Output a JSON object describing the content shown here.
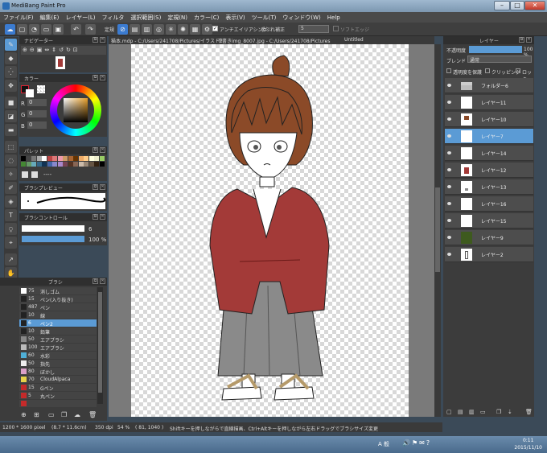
{
  "window": {
    "title": "MediBang Paint Pro"
  },
  "menu": [
    "ファイル(F)",
    "編集(E)",
    "レイヤー(L)",
    "フィルタ",
    "選択範囲(S)",
    "定規(N)",
    "カラー(C)",
    "表示(V)",
    "ツール(T)",
    "ウィンドウ(W)",
    "Help"
  ],
  "toolbar": {
    "ruler_label": "定規",
    "antialias_label": "アンチエイリアシング",
    "stabilizer_label": "手ぶれ補正",
    "stabilizer_value": "5",
    "soft_edge_label": "ソフトエッジ"
  },
  "doc_tabs": [
    "猫本.mdp - C:/Users/241708/Pictures/イラスト2",
    "下書きimg_8007.jpg - C:/Users/241708/Pictures",
    "Untitled"
  ],
  "navigator": {
    "title": "ナビゲーター"
  },
  "color": {
    "title": "カラー",
    "r": "0",
    "g": "0",
    "b": "0"
  },
  "palette": {
    "title": "パレット",
    "none_label": "----"
  },
  "brush_preview": {
    "title": "ブラシプレビュー"
  },
  "brush_control": {
    "title": "ブラシコントロール",
    "size_value": "6",
    "opacity_value": "100 %"
  },
  "brush_panel": {
    "title": "ブラシ",
    "items": [
      {
        "size": "75",
        "name": "消しゴム",
        "color": "#ffffff"
      },
      {
        "size": "15",
        "name": "ペン(入り抜き)",
        "color": "#222222"
      },
      {
        "size": "487",
        "name": "ペン",
        "color": "#222222"
      },
      {
        "size": "10",
        "name": "線",
        "color": "#222222"
      },
      {
        "size": "6",
        "name": "ペン2",
        "color": "#222222",
        "selected": true
      },
      {
        "size": "10",
        "name": "鉛筆",
        "color": "#222222"
      },
      {
        "size": "50",
        "name": "エアブラシ",
        "color": "#888888"
      },
      {
        "size": "100",
        "name": "エアブラシ",
        "color": "#bbbbbb"
      },
      {
        "size": "60",
        "name": "水彩",
        "color": "#4fb0d8"
      },
      {
        "size": "50",
        "name": "指先",
        "color": "#eeeeee"
      },
      {
        "size": "80",
        "name": "ぼかし",
        "color": "#d9a0c8"
      },
      {
        "size": "70",
        "name": "CloudAlpaca",
        "color": "#e6d24a"
      },
      {
        "size": "15",
        "name": "Gペン",
        "color": "#c52a2a"
      },
      {
        "size": "5",
        "name": "丸ペン",
        "color": "#c52a2a"
      },
      {
        "size": "",
        "name": "",
        "color": "#c52a2a"
      }
    ]
  },
  "layers_panel": {
    "title": "レイヤー",
    "opacity_label": "不透明度",
    "opacity_value": "100 %",
    "blend_label": "ブレンド",
    "blend_value": "通常",
    "protect_label": "透明度を保護",
    "clipping_label": "クリッピング",
    "lock_label": "ロック",
    "layers": [
      {
        "name": "フォルダー6",
        "thumb": "folder"
      },
      {
        "name": "レイヤー11",
        "thumb": "blank"
      },
      {
        "name": "レイヤー10",
        "thumb": "hair"
      },
      {
        "name": "レイヤー7",
        "thumb": "blank",
        "selected": true
      },
      {
        "name": "レイヤー14",
        "thumb": "blank"
      },
      {
        "name": "レイヤー12",
        "thumb": "kimono"
      },
      {
        "name": "レイヤー13",
        "thumb": "small"
      },
      {
        "name": "レイヤー16",
        "thumb": "blank"
      },
      {
        "name": "レイヤー15",
        "thumb": "blank"
      },
      {
        "name": "レイヤー9",
        "thumb": "green"
      },
      {
        "name": "レイヤー2",
        "thumb": "sketch"
      }
    ]
  },
  "status": {
    "canvas_size": "1200 * 1600 pixel",
    "physical_size": "(8.7 * 11.6cm)",
    "dpi": "350 dpi",
    "zoom": "54 %",
    "coords": "( 81, 1040 )",
    "hint": "Shiftキーを押しながらで直線描画、Ctrl+Altキーを押しながら左右ドラッグでブラシサイズ変更"
  },
  "taskbar": {
    "ime": "A 般",
    "time": "0:11",
    "date": "2015/11/10"
  },
  "colors": {
    "accent": "#5b9bd5",
    "kimono": "#a33a38",
    "hakama": "#8a8a8a",
    "hair": "#8b4a28"
  }
}
